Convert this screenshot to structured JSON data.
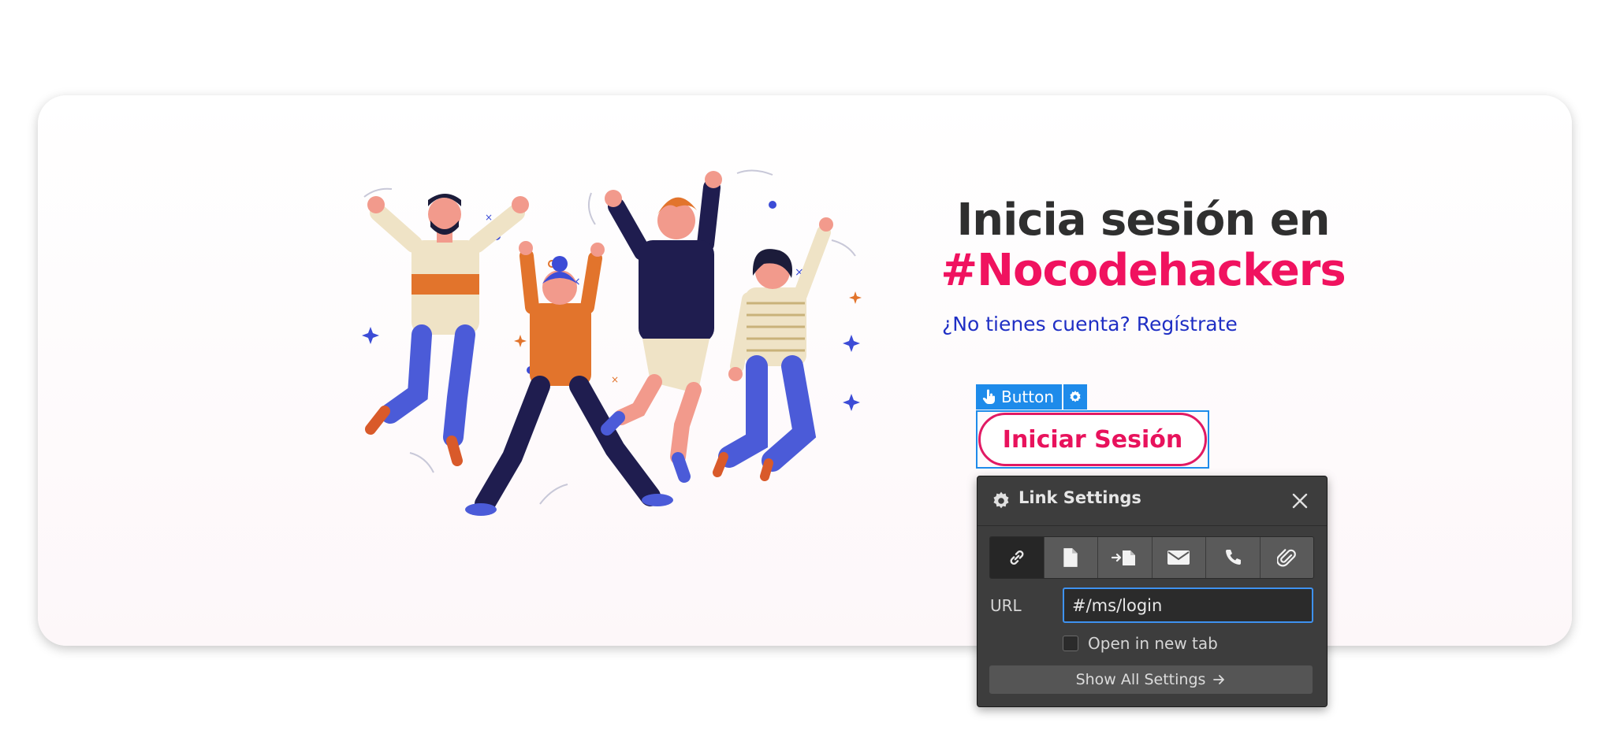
{
  "hero": {
    "title_line1": "Inicia sesión en",
    "title_line2": "#Nocodehackers",
    "signup_prompt": "¿No tienes cuenta? Regístrate"
  },
  "element_tag": {
    "label": "Button",
    "icons": [
      "hand-pointer-icon",
      "gear-icon"
    ],
    "color": "#1e8bea"
  },
  "login_button": {
    "label": "Iniciar Sesión",
    "color": "#e8125c"
  },
  "link_settings": {
    "title": "Link Settings",
    "link_types": [
      {
        "icon": "link-icon",
        "active": true
      },
      {
        "icon": "page-icon",
        "active": false
      },
      {
        "icon": "section-anchor-icon",
        "active": false
      },
      {
        "icon": "email-icon",
        "active": false
      },
      {
        "icon": "phone-icon",
        "active": false
      },
      {
        "icon": "attachment-icon",
        "active": false
      }
    ],
    "url_label": "URL",
    "url_value": "#/ms/login",
    "open_new_tab_label": "Open in new tab",
    "open_new_tab_checked": false,
    "show_all_label": "Show All Settings",
    "accent": "#3e92f0"
  },
  "colors": {
    "brand_pink": "#f0125f",
    "link_blue": "#1f2fc4",
    "heading_dark": "#2f2f2f"
  }
}
